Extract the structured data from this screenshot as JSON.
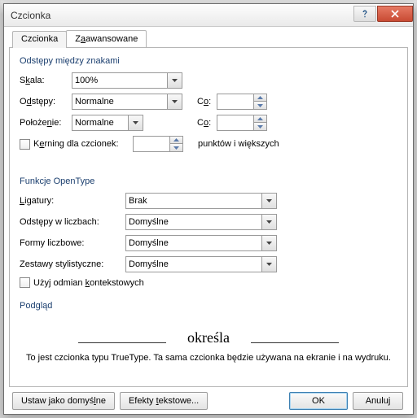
{
  "window": {
    "title": "Czcionka"
  },
  "tabs": {
    "font": "Czcionka",
    "advanced_pre": "Z",
    "advanced_u": "a",
    "advanced_post": "awansowane"
  },
  "spacing": {
    "title": "Odstępy między znakami",
    "scale_pre": "S",
    "scale_u": "k",
    "scale_post": "ala:",
    "scale_value": "100%",
    "spacing_pre": "O",
    "spacing_u": "d",
    "spacing_post": "stępy:",
    "spacing_value": "Normalne",
    "by_pre": "C",
    "by_u": "o",
    "by_post": ":",
    "by_value": "",
    "position_pre": "Położe",
    "position_u": "n",
    "position_post": "ie:",
    "position_value": "Normalne",
    "by2_pre": "C",
    "by2_u": "o",
    "by2_post": ":",
    "by2_value": "",
    "kerning_pre": "K",
    "kerning_u": "e",
    "kerning_post": "rning dla czcionek:",
    "kerning_value": "",
    "kerning_after": "punktów i większych"
  },
  "opentype": {
    "title": "Funkcje OpenType",
    "ligatures_pre": "",
    "ligatures_u": "L",
    "ligatures_post": "igatury:",
    "ligatures_value": "Brak",
    "numspacing_label": "Odstępy w liczbach:",
    "numspacing_value": "Domyślne",
    "numforms_label": "Formy liczbowe:",
    "numforms_value": "Domyślne",
    "stylistic_label": "Zestawy stylistyczne:",
    "stylistic_value": "Domyślne",
    "contextual_pre": "Użyj odmian ",
    "contextual_u": "k",
    "contextual_post": "ontekstowych"
  },
  "preview": {
    "title": "Podgląd",
    "sample": "określa",
    "description": "To jest czcionka typu TrueType. Ta sama czcionka będzie używana na ekranie i na wydruku."
  },
  "footer": {
    "default_pre": "Ustaw jako domyś",
    "default_u": "l",
    "default_post": "ne",
    "effects_pre": "Efekty ",
    "effects_u": "t",
    "effects_post": "ekstowe...",
    "ok": "OK",
    "cancel": "Anuluj"
  }
}
